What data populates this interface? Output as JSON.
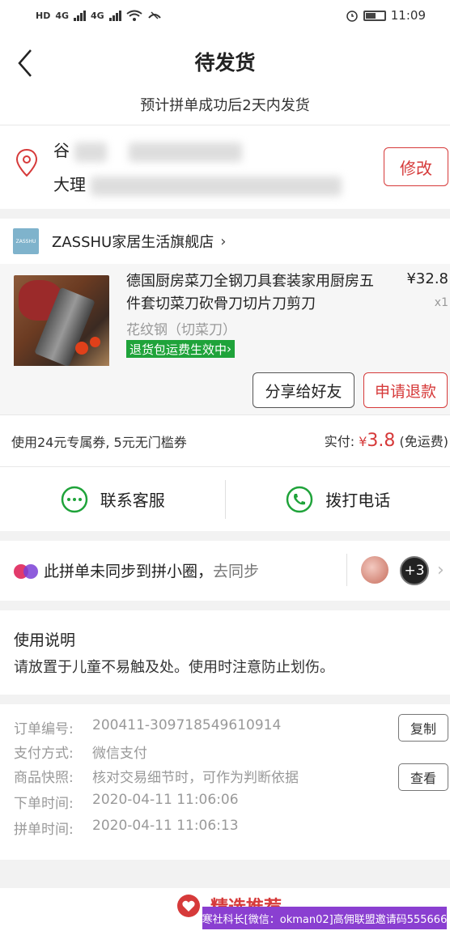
{
  "status_bar": {
    "left_label": "HD",
    "network": "4G",
    "time": "11:09"
  },
  "header": {
    "title": "待发货",
    "subtitle": "预计拼单成功后2天内发货"
  },
  "address": {
    "name_visible": "谷",
    "line2_visible": "大理",
    "edit_label": "修改"
  },
  "store": {
    "logo_text": "ZASSHU",
    "name": "ZASSHU家居生活旗舰店"
  },
  "product": {
    "title": "德国厨房菜刀全钢刀具套装家用厨房五件套切菜刀砍骨刀切片刀剪刀",
    "price": "¥32.8",
    "qty": "x1",
    "sku": "花纹钢（切菜刀）",
    "tag": "退货包运费生效中"
  },
  "actions": {
    "share": "分享给好友",
    "refund": "申请退款"
  },
  "payment": {
    "coupon_text": "使用24元专属券, 5元无门槛券",
    "paid_label": "实付:",
    "currency": "¥",
    "amount": "3.8",
    "shipping": "(免运费)"
  },
  "contact": {
    "service": "联系客服",
    "phone": "拨打电话"
  },
  "sync": {
    "text": "此拼单未同步到拼小圈，",
    "link": "去同步",
    "more_count": "+3"
  },
  "usage": {
    "title": "使用说明",
    "body": "请放置于儿童不易触及处。使用时注意防止划伤。"
  },
  "order": {
    "rows": [
      {
        "key": "订单编号:",
        "value": "200411-309718549610914"
      },
      {
        "key": "支付方式:",
        "value": "微信支付"
      },
      {
        "key": "商品快照:",
        "value": "核对交易细节时，可作为判断依据"
      },
      {
        "key": "下单时间:",
        "value": "2020-04-11 11:06:06"
      },
      {
        "key": "拼单时间:",
        "value": "2020-04-11 11:06:13"
      }
    ],
    "copy_label": "复制",
    "view_label": "查看"
  },
  "recommend": {
    "title": "精选推荐"
  },
  "watermark": "寒社科长[微信：okman02]高佣联盟邀请码555666",
  "colors": {
    "accent": "#d63a3a",
    "green": "#1fa33a"
  }
}
